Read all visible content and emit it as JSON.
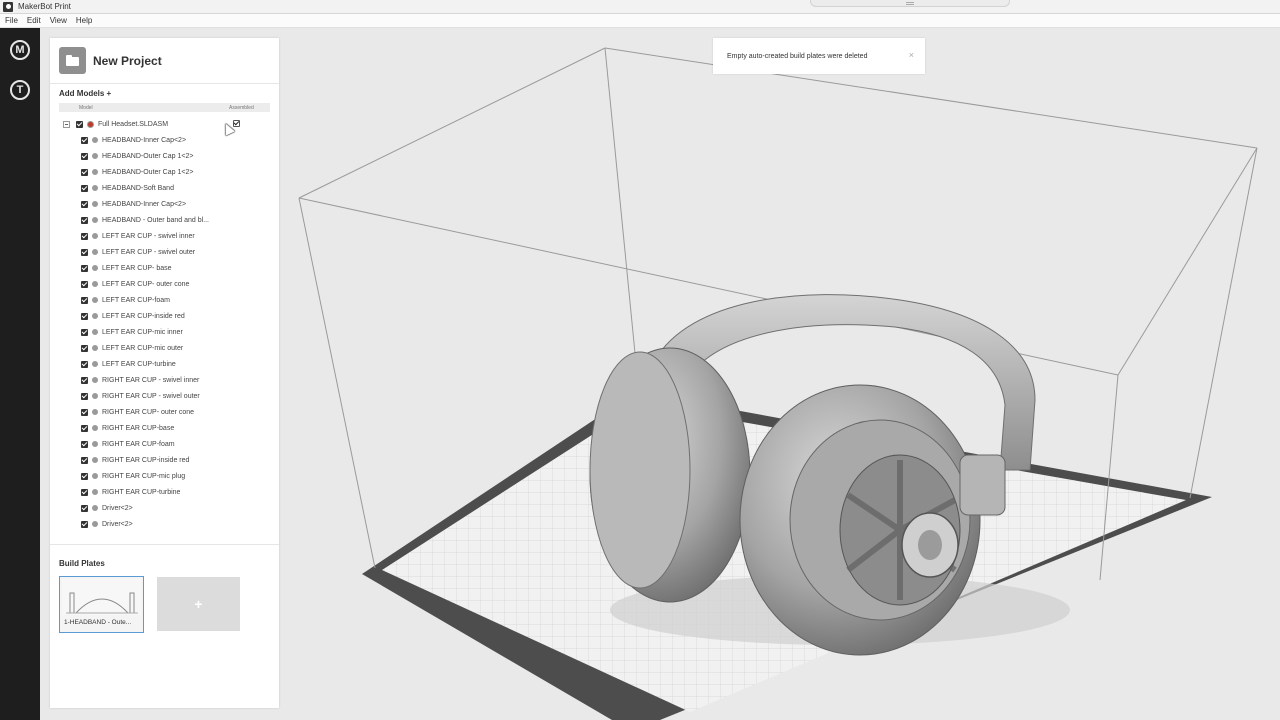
{
  "window": {
    "title": "MakerBot Print"
  },
  "menu": [
    "File",
    "Edit",
    "View",
    "Help"
  ],
  "rail": {
    "top_icon": "M",
    "bottom_icon": "T"
  },
  "project": {
    "title": "New Project"
  },
  "models": {
    "header": "Add Models +",
    "col_model": "Model",
    "col_assembled": "Assembled",
    "root": {
      "name": "Full Headset.SLDASM",
      "checked": true,
      "assembled": true
    },
    "items": [
      "HEADBAND-Inner Cap<2>",
      "HEADBAND-Outer Cap 1<2>",
      "HEADBAND-Outer Cap 1<2>",
      "HEADBAND-Soft Band",
      "HEADBAND-Inner Cap<2>",
      "HEADBAND - Outer band and bl...",
      "LEFT EAR CUP - swivel inner",
      "LEFT EAR CUP - swivel outer",
      "LEFT EAR CUP- base",
      "LEFT EAR CUP- outer cone",
      "LEFT EAR CUP-foam",
      "LEFT EAR CUP-inside red",
      "LEFT EAR CUP-mic inner",
      "LEFT EAR CUP-mic outer",
      "LEFT EAR CUP-turbine",
      "RIGHT EAR CUP - swivel inner",
      "RIGHT EAR CUP - swivel outer",
      "RIGHT EAR CUP- outer cone",
      "RIGHT EAR CUP-base",
      "RIGHT EAR CUP-foam",
      "RIGHT EAR CUP-inside red",
      "RIGHT EAR CUP-mic plug",
      "RIGHT EAR CUP-turbine",
      "Driver<2>",
      "Driver<2>"
    ]
  },
  "build_plates": {
    "title": "Build Plates",
    "plates": [
      {
        "label": "1-HEADBAND - Oute..."
      }
    ],
    "add_label": "+"
  },
  "toast": {
    "message": "Empty auto-created build plates were deleted",
    "close": "×"
  },
  "colors": {
    "rail": "#1e1e1e",
    "accent": "#5b9bd5",
    "plate": "#f1f1f1",
    "plate_border": "#4a4a4a"
  }
}
